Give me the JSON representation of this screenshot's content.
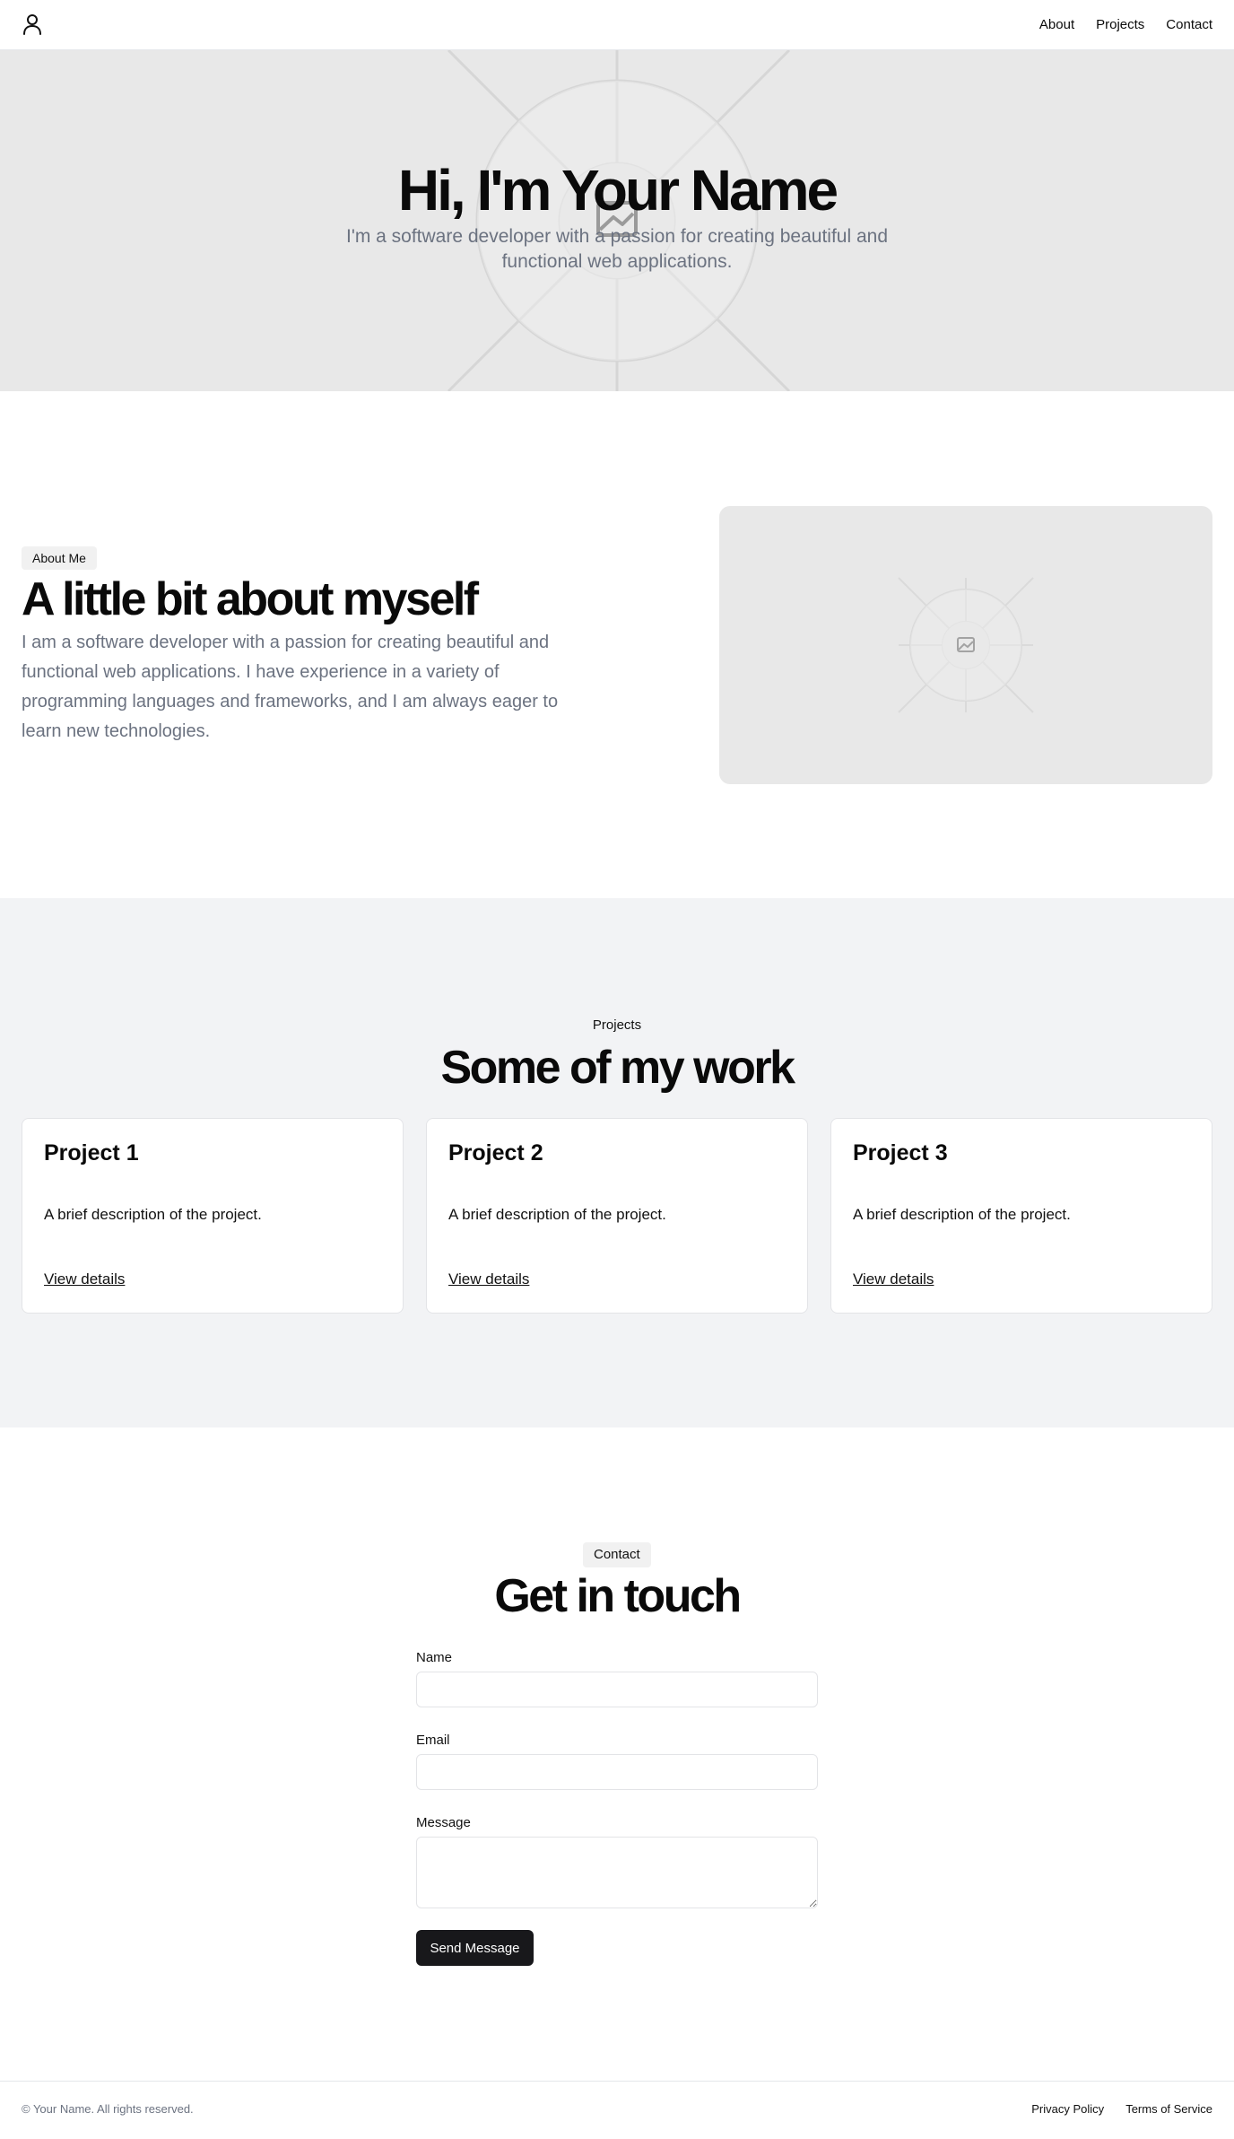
{
  "header": {
    "logo_icon": "user-icon",
    "nav": [
      "About",
      "Projects",
      "Contact"
    ]
  },
  "hero": {
    "title": "Hi, I'm Your Name",
    "subtitle": "I'm a software developer with a passion for creating beautiful and functional web applications.",
    "image_icon": "image-placeholder-icon"
  },
  "about": {
    "badge": "About Me",
    "title": "A little bit about myself",
    "text": "I am a software developer with a passion for creating beautiful and functional web applications. I have experience in a variety of programming languages and frameworks, and I am always eager to learn new technologies.",
    "image_icon": "image-placeholder-icon"
  },
  "projects": {
    "label": "Projects",
    "title": "Some of my work",
    "items": [
      {
        "title": "Project 1",
        "description": "A brief description of the project.",
        "link": "View details"
      },
      {
        "title": "Project 2",
        "description": "A brief description of the project.",
        "link": "View details"
      },
      {
        "title": "Project 3",
        "description": "A brief description of the project.",
        "link": "View details"
      }
    ]
  },
  "contact": {
    "badge": "Contact",
    "title": "Get in touch",
    "name_label": "Name",
    "name_value": "",
    "email_label": "Email",
    "email_value": "",
    "message_label": "Message",
    "message_value": "",
    "submit_label": "Send Message"
  },
  "footer": {
    "copyright": "© Your Name. All rights reserved.",
    "links": [
      "Privacy Policy",
      "Terms of Service"
    ]
  },
  "colors": {
    "hero_bg": "#e8e8e8",
    "muted_text": "#6b7280",
    "section_bg": "#f2f3f5",
    "button_bg": "#18181b"
  }
}
